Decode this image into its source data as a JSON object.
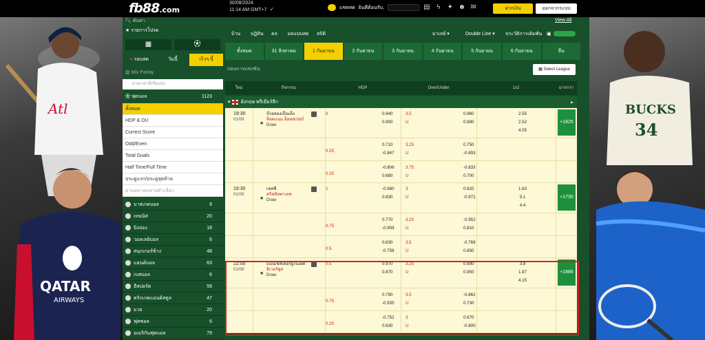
{
  "header": {
    "logo": "fb88",
    "logo_suffix": ".com",
    "date_line1": "30/08/2024",
    "date_line2": "11:14 AM GMT+7",
    "user_label": "แชทสด",
    "welcome": "ยินดีต้อนรับ,",
    "login_btn": "ฝากเงิน",
    "logout_btn": "ออกจากระบบ"
  },
  "sidebar": {
    "search": "ค้นหา",
    "favorites": "รายการโปรด",
    "tabs": [
      {
        "label": "● รอบสด"
      },
      {
        "label": "วันนี้"
      },
      {
        "label": "เร็วๆ นี้"
      }
    ],
    "mix_parlay": "Mix Parlay",
    "sort_label": "ตามเวลาที่เริ่มแข่ง",
    "football_label": "ฟุตบอล",
    "football_count": "1123",
    "markets": [
      {
        "label": "ทั้งหมด"
      },
      {
        "label": "HDP & OU"
      },
      {
        "label": "Correct Score"
      },
      {
        "label": "Odd/Even"
      },
      {
        "label": "Total Goals"
      },
      {
        "label": "Half Time/Full Time"
      },
      {
        "label": "ประตูแรก/ประตูสุดท้าย"
      },
      {
        "label": "ตามตลาดหลายตัวเลือก"
      }
    ],
    "sports": [
      {
        "label": "บาสเกตบอล",
        "count": "9"
      },
      {
        "label": "เทนนิส",
        "count": "20"
      },
      {
        "label": "ปิงปอง",
        "count": "18"
      },
      {
        "label": "วอลเลย์บอล",
        "count": "6"
      },
      {
        "label": "สนุกเกอร์ข้าง",
        "count": "48"
      },
      {
        "label": "แฮนด์บอล",
        "count": "63"
      },
      {
        "label": "เบสบอล",
        "count": "6"
      },
      {
        "label": "อีสปอร์ต",
        "count": "59"
      },
      {
        "label": "คริกเกตแอนด์สตูล",
        "count": "47"
      },
      {
        "label": "มวย",
        "count": "20"
      },
      {
        "label": "ฟุตซอล",
        "count": "6"
      },
      {
        "label": "อเมริกันฟุตบอล",
        "count": "79"
      }
    ]
  },
  "main": {
    "view_all": "View All",
    "filters": [
      "บ้าน",
      "ปฏิทิน",
      "คล",
      "ผลแบบสด",
      "สถิติ",
      "มาเลย์ ▾",
      "Double Line ▾",
      "ประวัติการเดิมพัน"
    ],
    "day_tabs": [
      {
        "label": "ทั้งหมด"
      },
      {
        "label": "31 สิงหาคม"
      },
      {
        "label": "1 กันยายน"
      },
      {
        "label": "2 กันยายน"
      },
      {
        "label": "3 กันยายน"
      },
      {
        "label": "4 กันยายน"
      },
      {
        "label": "5 กันยายน"
      },
      {
        "label": "6 กันยายน"
      },
      {
        "label": "อื่น"
      }
    ],
    "section_title": "ก่อนการแข่งขัน",
    "select_league": "Select League",
    "col_heads": [
      "ใหม่",
      "กิจกรรม",
      "HDP",
      "Over/Under",
      "1x2",
      "มากกว่า"
    ],
    "league": "อังกฤษ พรีเมียร์ลีก"
  },
  "matches": [
    {
      "time": "19:30",
      "date": "01/09",
      "home": "บ๊วยลองเป็นเต็ง",
      "away": "ท็อตแนม ฮ็อทสเปอร์",
      "draw": "Draw",
      "more": "+1825",
      "lines": [
        {
          "hdp_l": "0",
          "hdp_h": "0.940",
          "hdp_a": "0.900",
          "ou_l": "3.5",
          "ou_u": "U",
          "ou_o": "0.960",
          "ou_uv": "0.880",
          "x1": "2.55",
          "x2": "2.52",
          "x3": "4.05"
        },
        {
          "hdp_l": "0.25",
          "hdp_h": "0.710",
          "hdp_a": "-0.847",
          "ou_l": "3.25",
          "ou_u": "U",
          "ou_o": "0.750",
          "ou_uv": "-0.893"
        },
        {
          "hdp_l": "0.25",
          "hdp_h": "-0.806",
          "hdp_a": "0.680",
          "ou_l": "3.75",
          "ou_u": "U",
          "ou_o": "-0.833",
          "ou_uv": "0.700"
        }
      ]
    },
    {
      "time": "19:30",
      "date": "01/09",
      "home": "เชลซี",
      "away": "คริสตัลพาเลซ",
      "draw": "Draw",
      "more": "+1730",
      "lines": [
        {
          "hdp_l": "1",
          "hdp_h": "-0.980",
          "hdp_a": "0.830",
          "ou_l": "3",
          "ou_u": "U",
          "ou_o": "0.820",
          "ou_uv": "-0.971",
          "x1": "1.63",
          "x2": "5.1",
          "x3": "4.4"
        },
        {
          "hdp_l": "0.75",
          "hdp_h": "0.770",
          "hdp_a": "-0.909",
          "ou_l": "3.25",
          "ou_u": "U",
          "ou_o": "-0.952",
          "ou_uv": "0.810"
        },
        {
          "hdp_l": "0.5",
          "hdp_h": "0.630",
          "hdp_a": "-0.758",
          "ou_l": "3.5",
          "ou_u": "U",
          "ou_o": "-0.769",
          "ou_uv": "0.650"
        }
      ]
    },
    {
      "time": "22:00",
      "date": "01/09",
      "home": "แมนเชสเตอร์ยูไนเต็ด",
      "away": "ลิเวอร์พูล",
      "draw": "Draw",
      "more": "+1886",
      "lines": [
        {
          "hdp_l": "0.5",
          "hdp_h": "0.970",
          "hdp_a": "0.870",
          "ou_l": "3.25",
          "ou_u": "U",
          "ou_o": "0.890",
          "ou_uv": "0.950",
          "x1": "3.8",
          "x2": "1.87",
          "x3": "4.15"
        },
        {
          "hdp_l": "0.75",
          "hdp_h": "0.790",
          "hdp_a": "-0.935",
          "ou_l": "3.5",
          "ou_u": "U",
          "ou_o": "-0.862",
          "ou_uv": "0.730"
        },
        {
          "hdp_l": "0.25",
          "hdp_h": "-0.752",
          "hdp_a": "0.630",
          "ou_l": "3",
          "ou_u": "U",
          "ou_o": "0.670",
          "ou_uv": "-0.800"
        }
      ]
    }
  ],
  "colors": {
    "accent": "#f4d000",
    "green": "#17502a",
    "highlight": "#d32020"
  }
}
